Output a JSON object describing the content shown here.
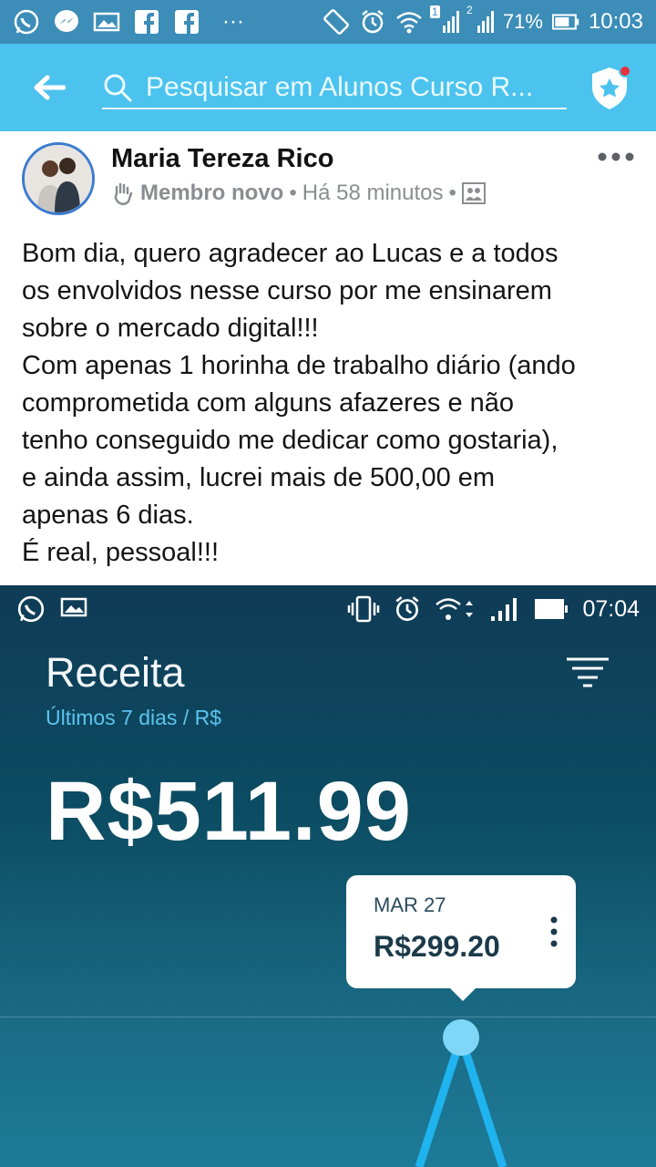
{
  "status_bar": {
    "battery": "71%",
    "time": "10:03",
    "sim1_badge": "1",
    "sim2_badge": "2",
    "more": "···"
  },
  "search": {
    "placeholder": "Pesquisar em Alunos Curso R..."
  },
  "post": {
    "author": "Maria Tereza Rico",
    "role": "Membro novo",
    "separator": "•",
    "time": "Há 58 minutos",
    "lines": [
      "Bom dia, quero agradecer ao Lucas e a todos",
      "os envolvidos nesse curso por me ensinarem",
      "sobre o mercado digital!!!",
      "Com apenas 1 horinha de trabalho diário (ando",
      "comprometida com alguns afazeres e não",
      "tenho conseguido me dedicar como gostaria),",
      "e ainda assim, lucrei mais de 500,00 em",
      "apenas 6 dias.",
      "É real, pessoal!!!"
    ]
  },
  "embed": {
    "time": "07:04",
    "title": "Receita",
    "subtitle": "Últimos 7 dias / R$",
    "total": "R$511.99",
    "tooltip": {
      "date": "MAR 27",
      "value": "R$299.20"
    }
  },
  "colors": {
    "status_bar": "#3c8db8",
    "header": "#4cc3ee",
    "embed_bg": "#0c4d63",
    "chart_line": "#1fb4ef",
    "chart_point": "#7fd6f7"
  }
}
